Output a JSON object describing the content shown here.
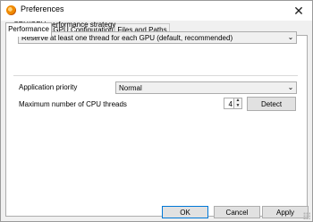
{
  "window": {
    "title": "Preferences",
    "app_icon": "app-logo-icon",
    "close_glyph": "✕"
  },
  "tabs": [
    {
      "label": "Performance",
      "active": true
    },
    {
      "label": "GPU Configuration",
      "active": false
    },
    {
      "label": "Files and Paths",
      "active": false
    }
  ],
  "performance": {
    "strategy_group_label": "CPU/GPU performance strategy",
    "strategy_value": "Reserve at least one thread for each GPU (default, recommended)",
    "priority_label": "Application priority",
    "priority_value": "Normal",
    "threads_label": "Maximum number of CPU threads",
    "threads_value": "4",
    "detect_label": "Detect"
  },
  "footer": {
    "ok_label": "OK",
    "cancel_label": "Cancel",
    "apply_label": "Apply"
  },
  "colors": {
    "accent": "#0078d7",
    "window_bg": "#f0f0f0",
    "panel_bg": "#ffffff"
  }
}
